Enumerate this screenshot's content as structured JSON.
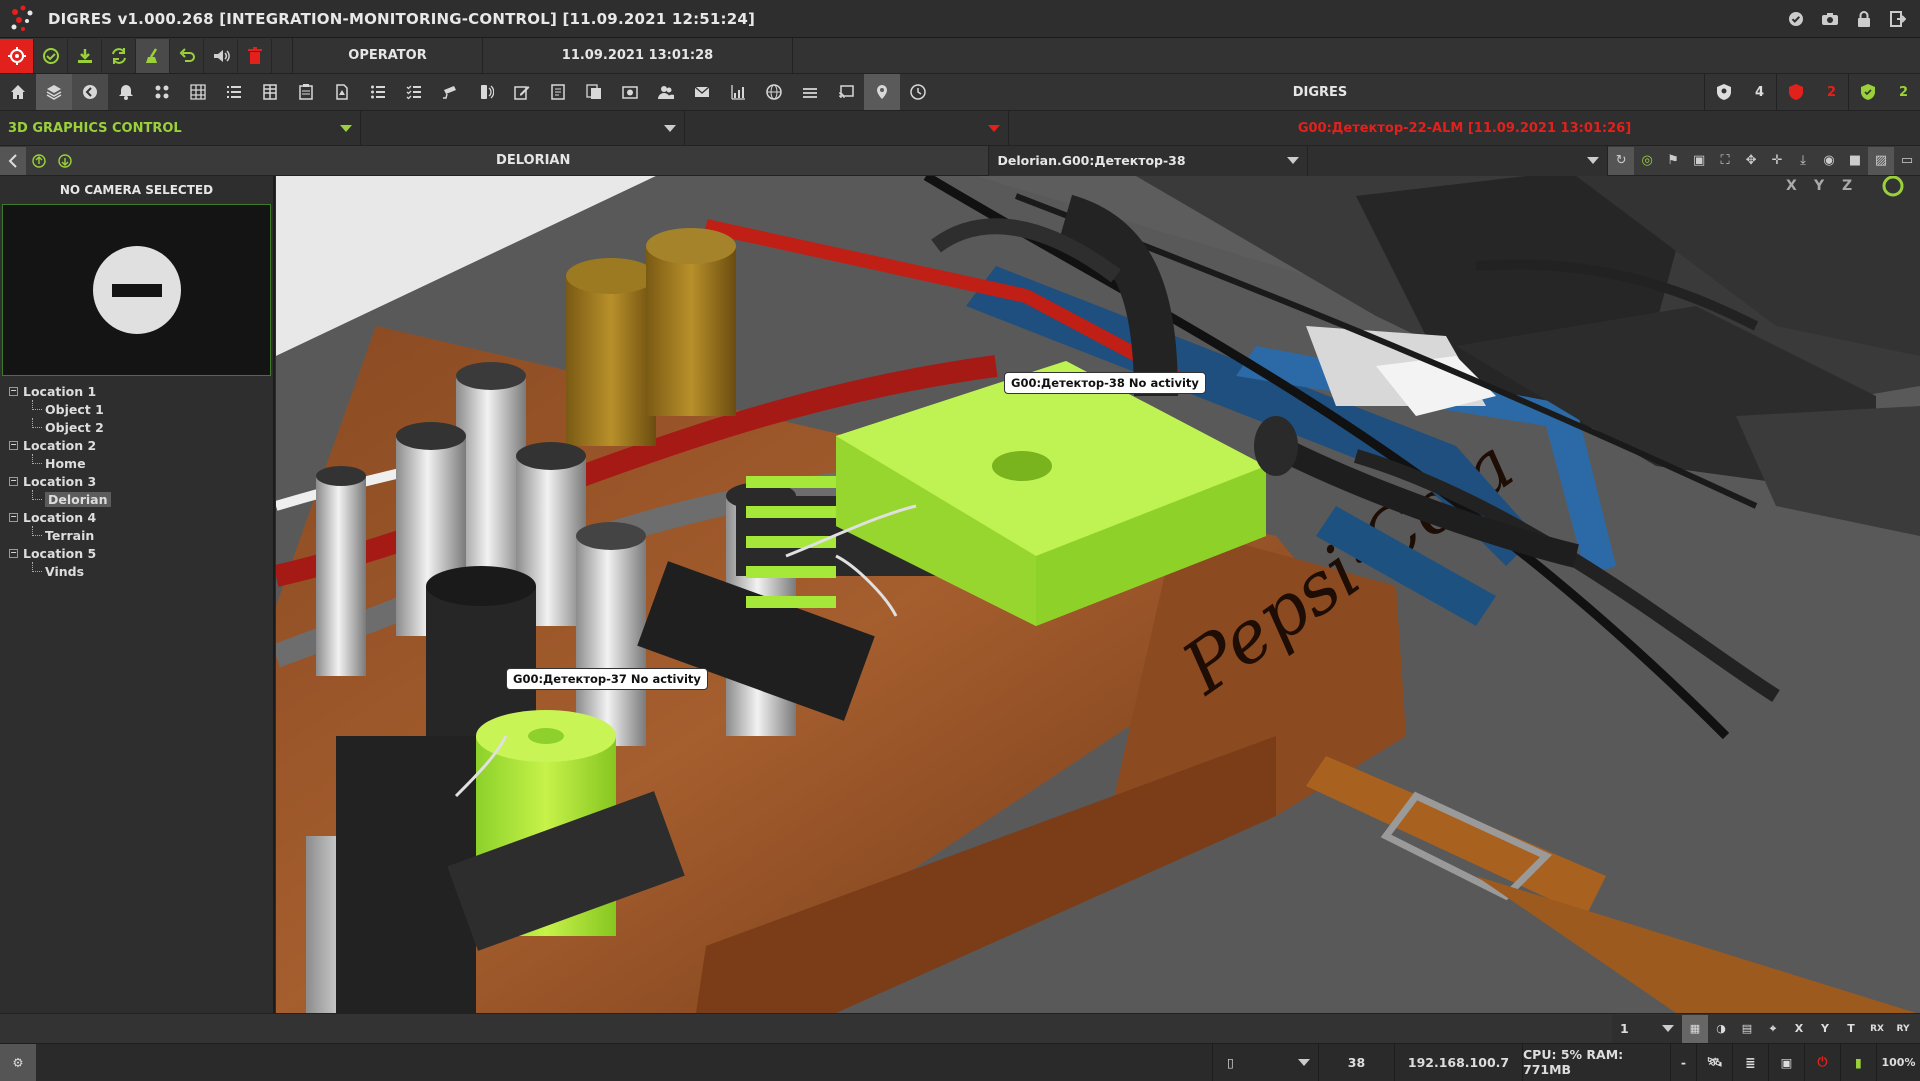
{
  "window": {
    "title": "DIGRES v1.000.268 [INTEGRATION-MONITORING-CONTROL] [11.09.2021 12:51:24]",
    "right_icons": [
      "check-circle-icon",
      "camera-icon",
      "lock-icon",
      "exit-icon"
    ]
  },
  "toolbar": {
    "role": "OPERATOR",
    "datetime": "11.09.2021 13:01:28"
  },
  "nav": {
    "app_name": "DIGRES",
    "counts": {
      "shield": "4",
      "alarm": "2",
      "ok": "2"
    }
  },
  "context": {
    "mode_label": "3D GRAPHICS CONTROL",
    "dropdown2_value": "",
    "dropdown3_value": "",
    "alarm_text": "G00:Детектор-22-ALM [11.09.2021 13:01:26]"
  },
  "scene": {
    "name": "DELORIAN",
    "selected_object": "Delorian.G00:Детектор-38",
    "dropdown2_value": "",
    "axis_labels": [
      "X",
      "Y",
      "Z"
    ]
  },
  "sidebar": {
    "camera_header": "NO CAMERA SELECTED",
    "tree": [
      {
        "label": "Location 1",
        "children": [
          "Object 1",
          "Object 2"
        ]
      },
      {
        "label": "Location 2",
        "children": [
          "Home"
        ]
      },
      {
        "label": "Location 3",
        "children": [
          "Delorian"
        ]
      },
      {
        "label": "Location 4",
        "children": [
          "Terrain"
        ]
      },
      {
        "label": "Location 5",
        "children": [
          "Vinds"
        ]
      }
    ],
    "selected": "Delorian"
  },
  "labels": {
    "det38": "G00:Детектор-38 No activity",
    "det37": "G00:Детектор-37 No activity"
  },
  "bottom": {
    "layer_value": "1",
    "view_buttons": [
      "X",
      "Y",
      "T",
      "RX",
      "RY"
    ],
    "status": {
      "dropdown_value": "",
      "count": "38",
      "ip": "192.168.100.7",
      "resources": "CPU: 5% RAM: 771MB",
      "dash": "-",
      "zoom": "100%"
    }
  },
  "colors": {
    "accent_green": "#9ad13b",
    "alarm_red": "#e2211c",
    "detector_green": "#a5e83a",
    "background": "#2b2b2b"
  }
}
